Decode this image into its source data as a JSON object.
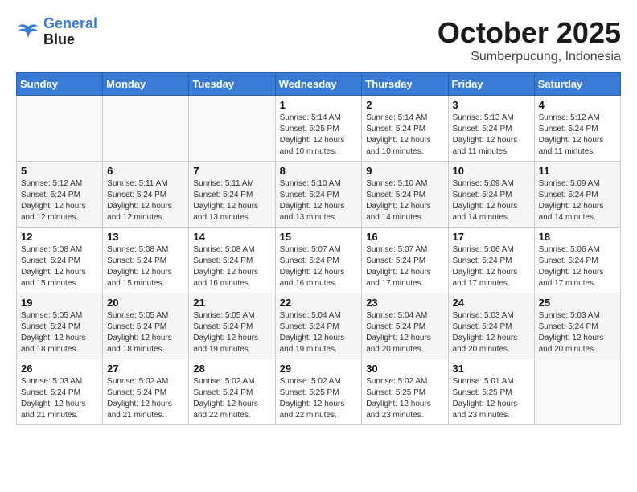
{
  "header": {
    "logo_line1": "General",
    "logo_line2": "Blue",
    "month": "October 2025",
    "location": "Sumberpucung, Indonesia"
  },
  "weekdays": [
    "Sunday",
    "Monday",
    "Tuesday",
    "Wednesday",
    "Thursday",
    "Friday",
    "Saturday"
  ],
  "weeks": [
    [
      {
        "day": "",
        "info": ""
      },
      {
        "day": "",
        "info": ""
      },
      {
        "day": "",
        "info": ""
      },
      {
        "day": "1",
        "info": "Sunrise: 5:14 AM\nSunset: 5:25 PM\nDaylight: 12 hours\nand 10 minutes."
      },
      {
        "day": "2",
        "info": "Sunrise: 5:14 AM\nSunset: 5:24 PM\nDaylight: 12 hours\nand 10 minutes."
      },
      {
        "day": "3",
        "info": "Sunrise: 5:13 AM\nSunset: 5:24 PM\nDaylight: 12 hours\nand 11 minutes."
      },
      {
        "day": "4",
        "info": "Sunrise: 5:12 AM\nSunset: 5:24 PM\nDaylight: 12 hours\nand 11 minutes."
      }
    ],
    [
      {
        "day": "5",
        "info": "Sunrise: 5:12 AM\nSunset: 5:24 PM\nDaylight: 12 hours\nand 12 minutes."
      },
      {
        "day": "6",
        "info": "Sunrise: 5:11 AM\nSunset: 5:24 PM\nDaylight: 12 hours\nand 12 minutes."
      },
      {
        "day": "7",
        "info": "Sunrise: 5:11 AM\nSunset: 5:24 PM\nDaylight: 12 hours\nand 13 minutes."
      },
      {
        "day": "8",
        "info": "Sunrise: 5:10 AM\nSunset: 5:24 PM\nDaylight: 12 hours\nand 13 minutes."
      },
      {
        "day": "9",
        "info": "Sunrise: 5:10 AM\nSunset: 5:24 PM\nDaylight: 12 hours\nand 14 minutes."
      },
      {
        "day": "10",
        "info": "Sunrise: 5:09 AM\nSunset: 5:24 PM\nDaylight: 12 hours\nand 14 minutes."
      },
      {
        "day": "11",
        "info": "Sunrise: 5:09 AM\nSunset: 5:24 PM\nDaylight: 12 hours\nand 14 minutes."
      }
    ],
    [
      {
        "day": "12",
        "info": "Sunrise: 5:08 AM\nSunset: 5:24 PM\nDaylight: 12 hours\nand 15 minutes."
      },
      {
        "day": "13",
        "info": "Sunrise: 5:08 AM\nSunset: 5:24 PM\nDaylight: 12 hours\nand 15 minutes."
      },
      {
        "day": "14",
        "info": "Sunrise: 5:08 AM\nSunset: 5:24 PM\nDaylight: 12 hours\nand 16 minutes."
      },
      {
        "day": "15",
        "info": "Sunrise: 5:07 AM\nSunset: 5:24 PM\nDaylight: 12 hours\nand 16 minutes."
      },
      {
        "day": "16",
        "info": "Sunrise: 5:07 AM\nSunset: 5:24 PM\nDaylight: 12 hours\nand 17 minutes."
      },
      {
        "day": "17",
        "info": "Sunrise: 5:06 AM\nSunset: 5:24 PM\nDaylight: 12 hours\nand 17 minutes."
      },
      {
        "day": "18",
        "info": "Sunrise: 5:06 AM\nSunset: 5:24 PM\nDaylight: 12 hours\nand 17 minutes."
      }
    ],
    [
      {
        "day": "19",
        "info": "Sunrise: 5:05 AM\nSunset: 5:24 PM\nDaylight: 12 hours\nand 18 minutes."
      },
      {
        "day": "20",
        "info": "Sunrise: 5:05 AM\nSunset: 5:24 PM\nDaylight: 12 hours\nand 18 minutes."
      },
      {
        "day": "21",
        "info": "Sunrise: 5:05 AM\nSunset: 5:24 PM\nDaylight: 12 hours\nand 19 minutes."
      },
      {
        "day": "22",
        "info": "Sunrise: 5:04 AM\nSunset: 5:24 PM\nDaylight: 12 hours\nand 19 minutes."
      },
      {
        "day": "23",
        "info": "Sunrise: 5:04 AM\nSunset: 5:24 PM\nDaylight: 12 hours\nand 20 minutes."
      },
      {
        "day": "24",
        "info": "Sunrise: 5:03 AM\nSunset: 5:24 PM\nDaylight: 12 hours\nand 20 minutes."
      },
      {
        "day": "25",
        "info": "Sunrise: 5:03 AM\nSunset: 5:24 PM\nDaylight: 12 hours\nand 20 minutes."
      }
    ],
    [
      {
        "day": "26",
        "info": "Sunrise: 5:03 AM\nSunset: 5:24 PM\nDaylight: 12 hours\nand 21 minutes."
      },
      {
        "day": "27",
        "info": "Sunrise: 5:02 AM\nSunset: 5:24 PM\nDaylight: 12 hours\nand 21 minutes."
      },
      {
        "day": "28",
        "info": "Sunrise: 5:02 AM\nSunset: 5:24 PM\nDaylight: 12 hours\nand 22 minutes."
      },
      {
        "day": "29",
        "info": "Sunrise: 5:02 AM\nSunset: 5:25 PM\nDaylight: 12 hours\nand 22 minutes."
      },
      {
        "day": "30",
        "info": "Sunrise: 5:02 AM\nSunset: 5:25 PM\nDaylight: 12 hours\nand 23 minutes."
      },
      {
        "day": "31",
        "info": "Sunrise: 5:01 AM\nSunset: 5:25 PM\nDaylight: 12 hours\nand 23 minutes."
      },
      {
        "day": "",
        "info": ""
      }
    ]
  ]
}
